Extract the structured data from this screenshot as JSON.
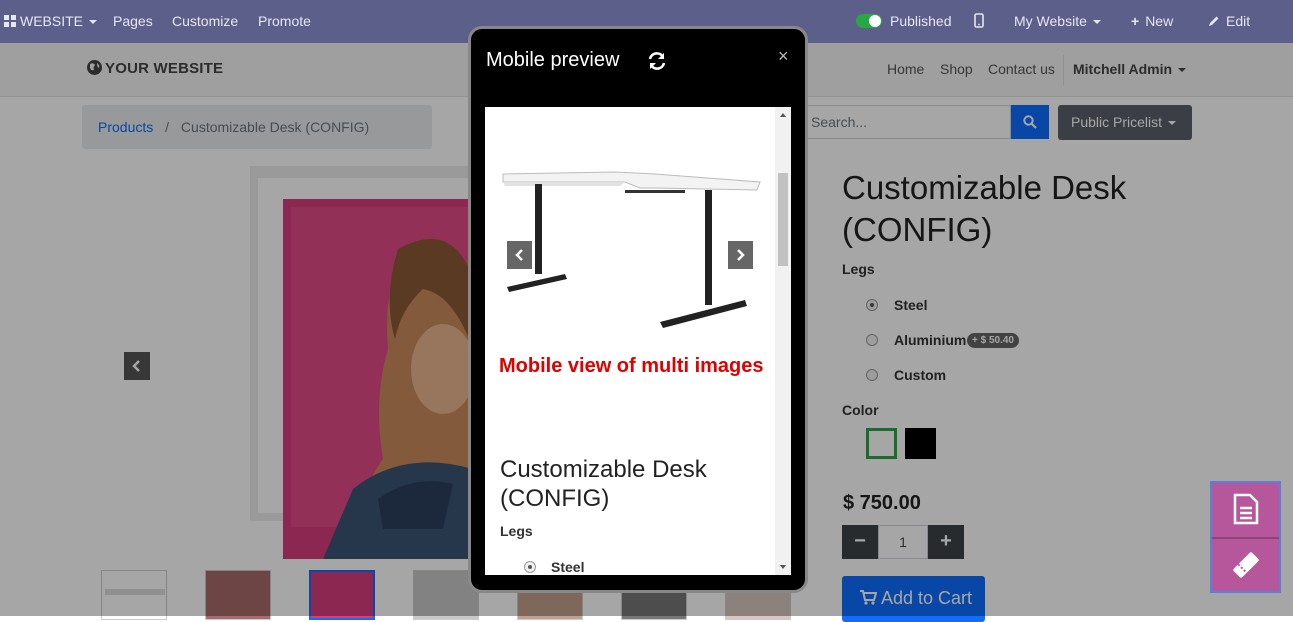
{
  "topbar": {
    "website_label": "WEBSITE",
    "menu": [
      "Pages",
      "Customize",
      "Promote"
    ],
    "published_label": "Published",
    "my_website_label": "My Website",
    "new_label": "New",
    "edit_label": "Edit"
  },
  "site": {
    "logo_text": "YOUR WEBSITE",
    "nav": [
      "Home",
      "Shop",
      "Contact us"
    ],
    "user": "Mitchell Admin"
  },
  "breadcrumb": {
    "parent": "Products",
    "separator": "/",
    "current": "Customizable Desk (CONFIG)"
  },
  "search": {
    "placeholder": "Search..."
  },
  "pricelist_label": "Public Pricelist",
  "product": {
    "title": "Customizable Desk (CONFIG)",
    "legs_label": "Legs",
    "legs_options": [
      "Steel",
      "Aluminium",
      "Custom"
    ],
    "aluminium_extra": "+ $ 50.40",
    "color_label": "Color",
    "colors": [
      "#ffffff",
      "#000000"
    ],
    "price": "$ 750.00",
    "quantity": "1",
    "minus": "−",
    "plus": "+",
    "add_to_cart": "Add to Cart"
  },
  "modal": {
    "title": "Mobile preview",
    "close": "×",
    "annotation": "Mobile view of multi images",
    "product_title": "Customizable Desk (CONFIG)",
    "legs_label": "Legs",
    "first_option": "Steel"
  },
  "colors": {
    "topbar": "#5b5f8a",
    "primary": "#0d6efd",
    "annotation": "#e00000",
    "widget": "#b5579a"
  }
}
